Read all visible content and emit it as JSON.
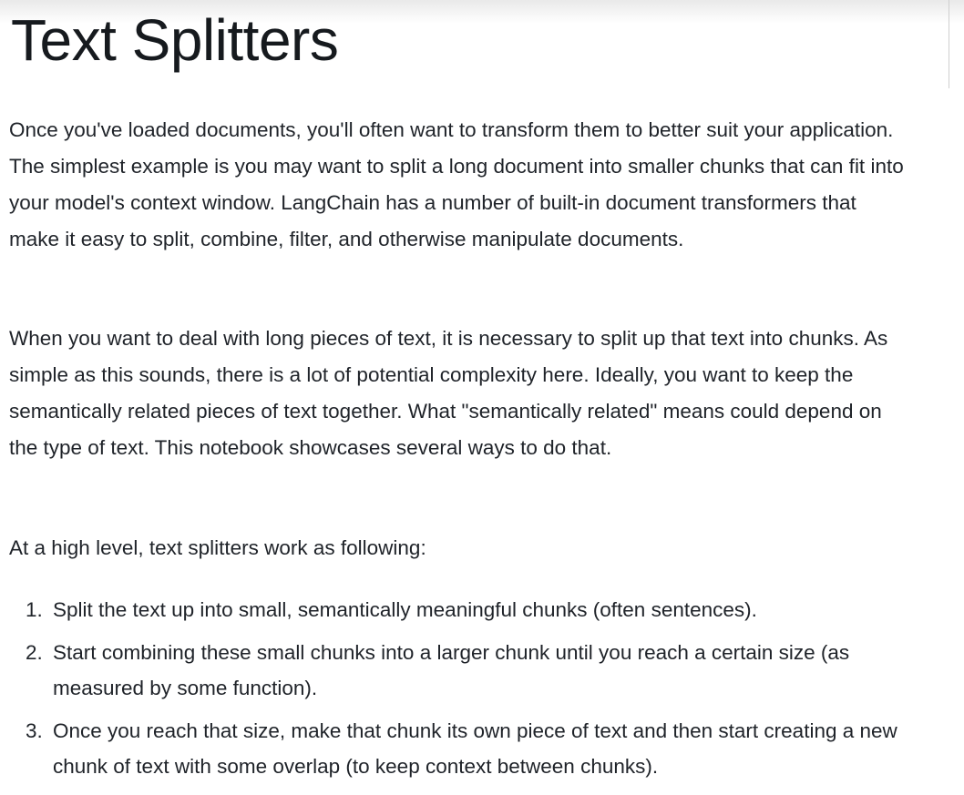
{
  "title": "Text Splitters",
  "paragraphs": [
    "Once you've loaded documents, you'll often want to transform them to better suit your application. The simplest example is you may want to split a long document into smaller chunks that can fit into your model's context window. LangChain has a number of built-in document transformers that make it easy to split, combine, filter, and otherwise manipulate documents.",
    "When you want to deal with long pieces of text, it is necessary to split up that text into chunks. As simple as this sounds, there is a lot of potential complexity here. Ideally, you want to keep the semantically related pieces of text together. What \"semantically related\" means could depend on the type of text. This notebook showcases several ways to do that.",
    "At a high level, text splitters work as following:"
  ],
  "steps": [
    {
      "number": "1.",
      "text": "Split the text up into small, semantically meaningful chunks (often sentences)."
    },
    {
      "number": "2.",
      "text": "Start combining these small chunks into a larger chunk until you reach a certain size (as measured by some function)."
    },
    {
      "number": "3.",
      "text": "Once you reach that size, make that chunk its own piece of text and then start creating a new chunk of text with some overlap (to keep context between chunks)."
    }
  ]
}
